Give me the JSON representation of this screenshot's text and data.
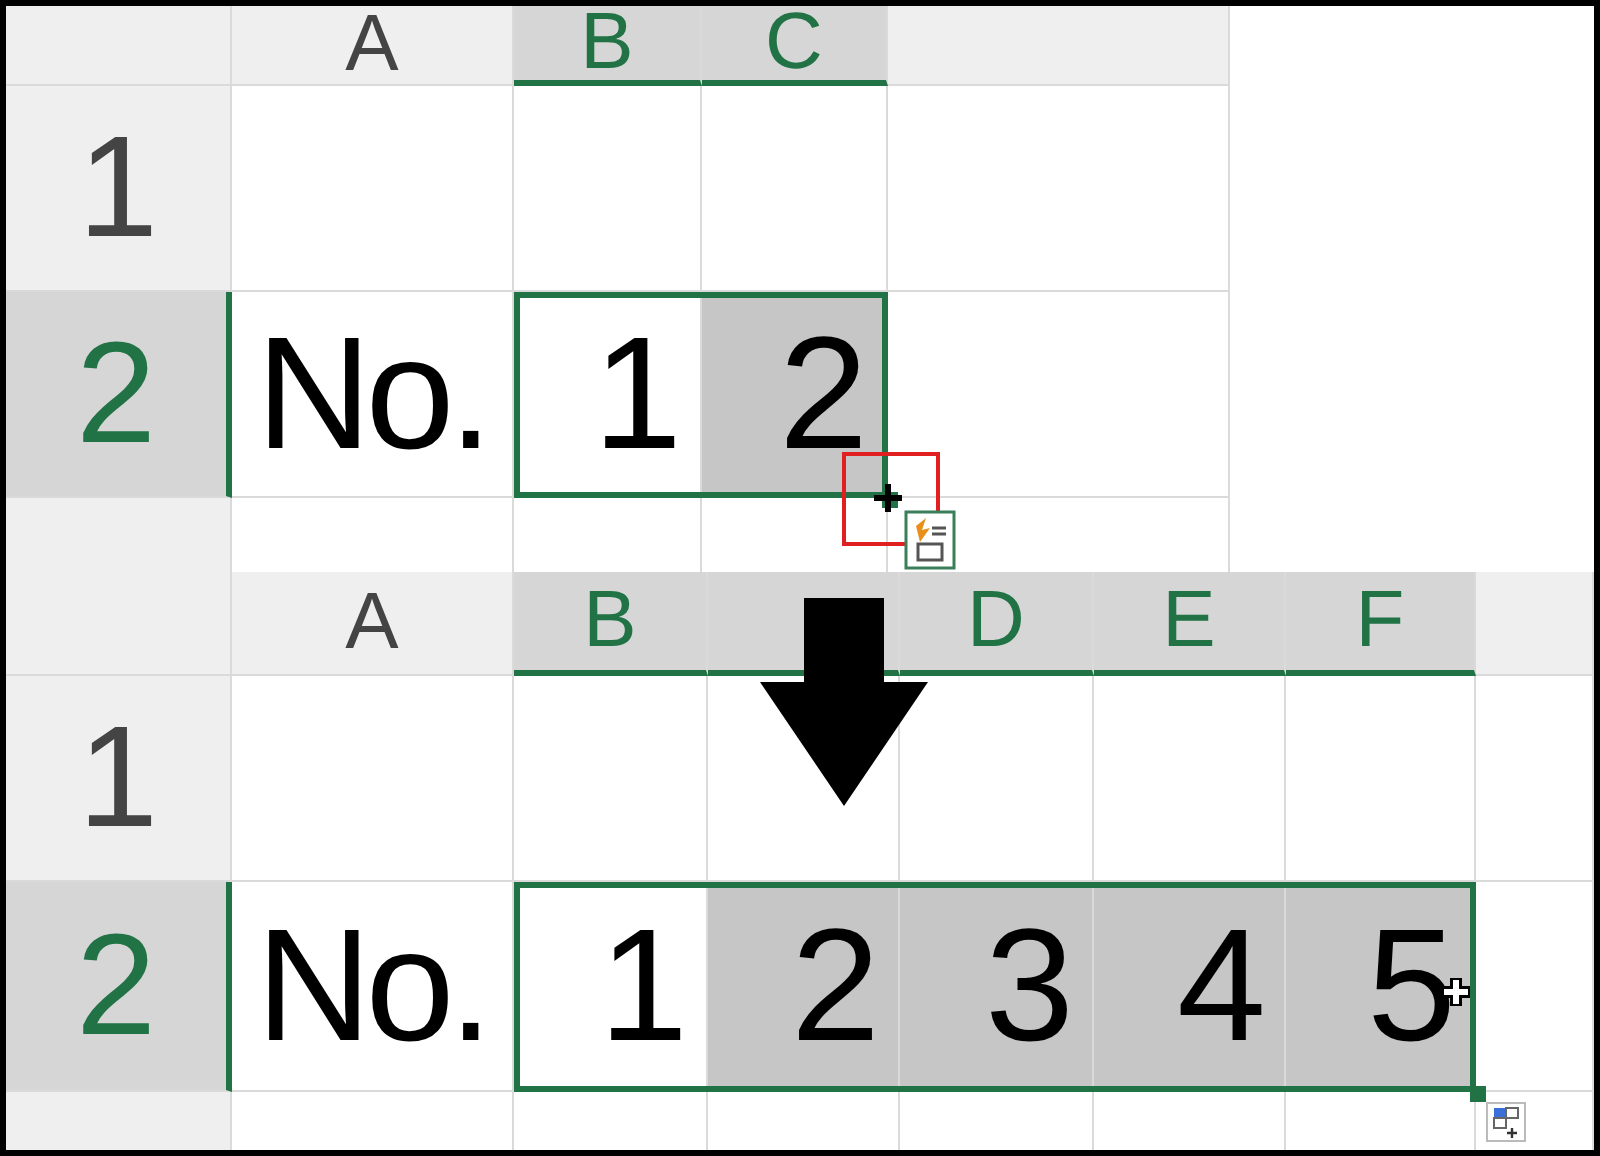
{
  "panels": [
    {
      "columns": [
        {
          "label": "A",
          "selected": false
        },
        {
          "label": "B",
          "selected": true
        },
        {
          "label": "C",
          "selected": true
        }
      ],
      "rows": [
        {
          "label": "1",
          "selected": false,
          "cells": []
        },
        {
          "label": "2",
          "selected": true,
          "cells": [
            {
              "value": "No.",
              "kind": "text",
              "selected": false
            },
            {
              "value": "1",
              "kind": "number",
              "selected": false
            },
            {
              "value": "2",
              "kind": "number",
              "selected": true
            }
          ]
        }
      ],
      "cursor": {
        "kind": "fill-drag"
      }
    },
    {
      "columns": [
        {
          "label": "A",
          "selected": false
        },
        {
          "label": "B",
          "selected": true
        },
        {
          "selected": true
        },
        {
          "label": "D",
          "selected": true
        },
        {
          "label": "E",
          "selected": true
        },
        {
          "label": "F",
          "selected": true
        }
      ],
      "rows": [
        {
          "label": "1",
          "selected": false,
          "cells": []
        },
        {
          "label": "2",
          "selected": true,
          "cells": [
            {
              "value": "No.",
              "kind": "text",
              "selected": false
            },
            {
              "value": "1",
              "kind": "number",
              "selected": false
            },
            {
              "value": "2",
              "kind": "number",
              "selected": true
            },
            {
              "value": "3",
              "kind": "number",
              "selected": true
            },
            {
              "value": "4",
              "kind": "number",
              "selected": true
            },
            {
              "value": "5",
              "kind": "number",
              "selected": true
            }
          ]
        }
      ],
      "cursor": {
        "kind": "fill-done"
      }
    }
  ]
}
